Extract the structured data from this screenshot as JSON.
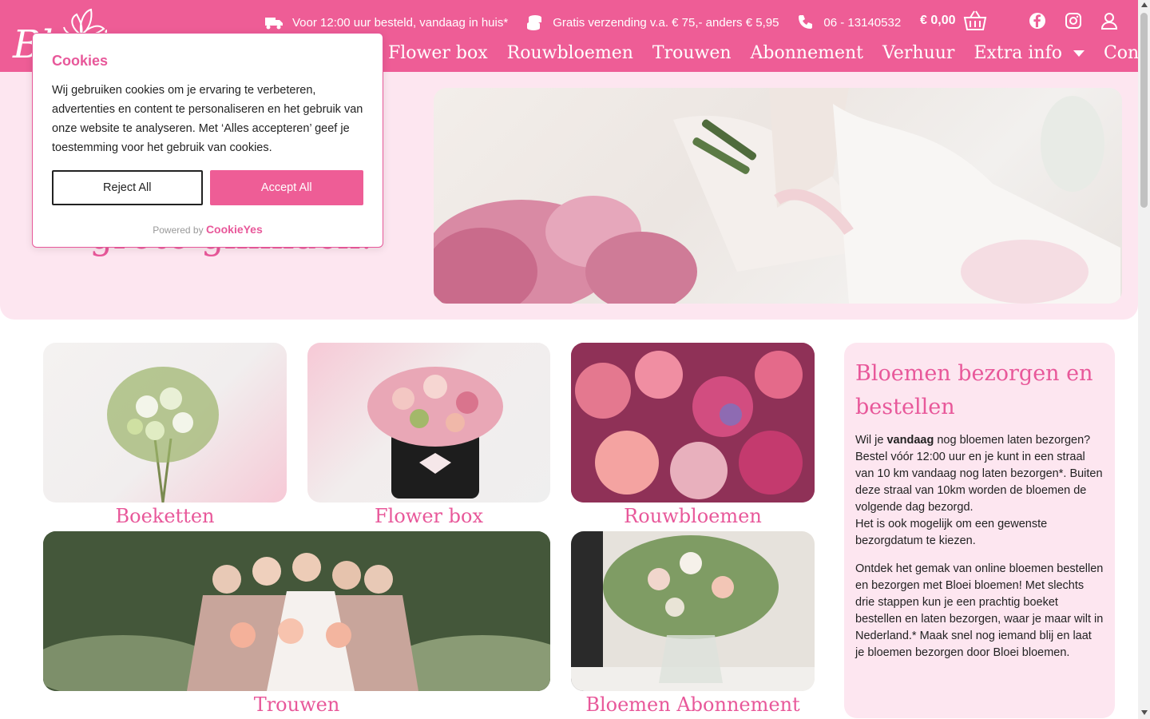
{
  "header": {
    "logo_text": "Bloei",
    "topbar": {
      "delivery": "Voor 12:00 uur besteld, vandaag in huis*",
      "shipping": "Gratis verzending v.a. € 75,- anders € 5,95",
      "phone": "06 - 13140532"
    },
    "cart_total": "€ 0,00",
    "nav": [
      "Flower box",
      "Rouwbloemen",
      "Trouwen",
      "Abonnement",
      "Verhuur",
      "Extra info",
      "Contact"
    ]
  },
  "hero": {
    "text": "grote glimlach."
  },
  "cards": [
    {
      "label": "Boeketten"
    },
    {
      "label": "Flower box"
    },
    {
      "label": "Rouwbloemen"
    },
    {
      "label": "Trouwen"
    },
    {
      "label": "Bloemen Abonnement"
    }
  ],
  "sidebar": {
    "title": "Bloemen bezorgen en bestellen",
    "p1_pre": "Wil je ",
    "p1_bold": "vandaag",
    "p1_post": " nog bloemen laten bezorgen? Bestel vóór 12:00 uur en je kunt in een straal van 10 km vandaag nog laten bezorgen*. Buiten deze straal van 10km worden de bloemen de volgende dag bezorgd.",
    "p1_extra": "Het is ook mogelijk om een gewenste bezorgdatum te kiezen.",
    "p2": "Ontdek het gemak van online bloemen bestellen en bezorgen met Bloei bloemen!  Met slechts drie stappen kun je een prachtig boeket bestellen en laten bezorgen, waar je maar wilt in Nederland.* Maak snel nog iemand blij en laat je bloemen bezorgen door Bloei bloemen."
  },
  "cookie": {
    "title": "Cookies",
    "text": "Wij gebruiken cookies om je ervaring te verbeteren, advertenties en content te personaliseren en het gebruik van onze website te analyseren. Met ‘Alles accepteren’ geef je toestemming voor het gebruik van cookies.",
    "reject": "Reject All",
    "accept": "Accept All",
    "powered": "Powered by",
    "brand": "CookieYes"
  }
}
